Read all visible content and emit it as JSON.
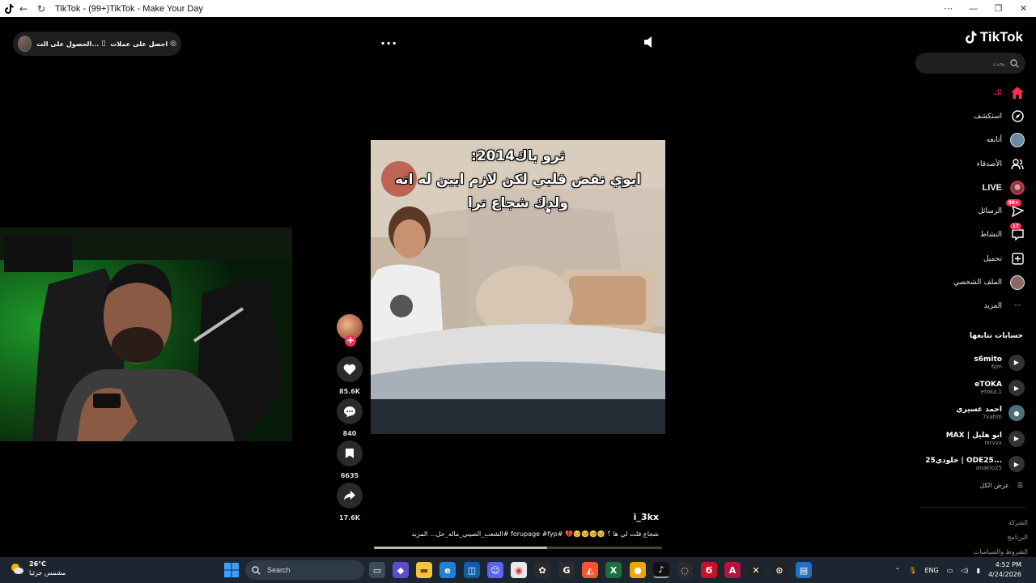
{
  "window": {
    "title": "TikTok - (99+)TikTok - Make Your Day",
    "icons": [
      "tiktok-icon",
      "back-icon",
      "reload-icon",
      "menu-dots-icon",
      "minimize-icon",
      "maximize-icon",
      "close-icon"
    ]
  },
  "top_pill": {
    "item1_label": "احصل على عملات",
    "item2_label": "الحصول على الت..."
  },
  "video": {
    "caption_line1": "ثرو باك2014:",
    "caption_line2": "ابوي نفض قلبي لكن لازم ابين له انه",
    "caption_line3": "ولدك شجاع ترا",
    "username": "i_3kx",
    "description": "شجاع قلت لي ها ؟ 🥺🥺🥺🥺💔 #forupage #fyp #الشعب_الصيني_ماله_حل... المزيد",
    "progress": 0.6
  },
  "actions": {
    "likes": "85.6K",
    "comments": "840",
    "saves": "6635",
    "shares": "17.6K"
  },
  "sidebar": {
    "logo_text": "TikTok",
    "search_placeholder": "بحث",
    "nav": [
      {
        "label": "لك",
        "icon": "home-icon"
      },
      {
        "label": "استكشف",
        "icon": "compass-icon"
      },
      {
        "label": "أتابعه",
        "icon": "avatar"
      },
      {
        "label": "الأصدقاء",
        "icon": "friends-icon"
      },
      {
        "label": "LIVE",
        "icon": "live-icon"
      },
      {
        "label": "الرسائل",
        "icon": "messages-icon",
        "badge": "99+"
      },
      {
        "label": "النشاط",
        "icon": "activity-icon",
        "badge": "17"
      },
      {
        "label": "تحميل",
        "icon": "upload-icon"
      },
      {
        "label": "الملف الشخصي",
        "icon": "profile-avatar"
      },
      {
        "label": "المزيد",
        "icon": "more-icon"
      }
    ],
    "following_heading": "حسابات تتابعها",
    "following": [
      {
        "name": "s6mito",
        "user": "6jm"
      },
      {
        "name": "eTOKA",
        "user": "etoka.1"
      },
      {
        "name": "احمد عسيري",
        "user": "7vahm"
      },
      {
        "name": "MAX | ابو هليل",
        "user": "nirvvx"
      },
      {
        "name": "خلودي25 | ODE25...",
        "user": "anaklo25"
      }
    ],
    "view_all": "عرض الكل",
    "footer": [
      "الشركة",
      "البرنامج",
      "الشروط والسياسات"
    ]
  },
  "taskbar": {
    "temperature": "26°C",
    "weather_desc": "مشمس جزئيا",
    "search_label": "Search",
    "language": "ENG",
    "time": "4:52 PM",
    "date": "4/24/2026"
  },
  "colors": {
    "accent": "#fe2c55",
    "background": "#000000",
    "taskbar": "#1c2530"
  }
}
